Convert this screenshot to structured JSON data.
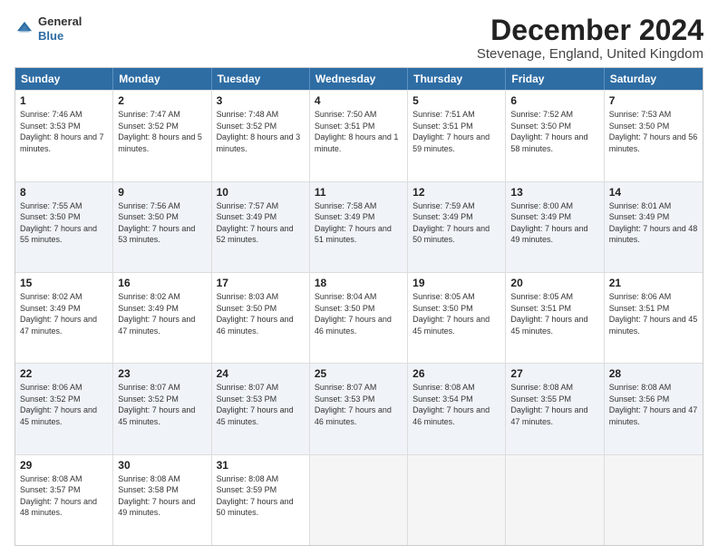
{
  "logo": {
    "general": "General",
    "blue": "Blue"
  },
  "title": "December 2024",
  "subtitle": "Stevenage, England, United Kingdom",
  "days": [
    "Sunday",
    "Monday",
    "Tuesday",
    "Wednesday",
    "Thursday",
    "Friday",
    "Saturday"
  ],
  "rows": [
    [
      {
        "day": "1",
        "sunrise": "Sunrise: 7:46 AM",
        "sunset": "Sunset: 3:53 PM",
        "daylight": "Daylight: 8 hours and 7 minutes.",
        "empty": false
      },
      {
        "day": "2",
        "sunrise": "Sunrise: 7:47 AM",
        "sunset": "Sunset: 3:52 PM",
        "daylight": "Daylight: 8 hours and 5 minutes.",
        "empty": false
      },
      {
        "day": "3",
        "sunrise": "Sunrise: 7:48 AM",
        "sunset": "Sunset: 3:52 PM",
        "daylight": "Daylight: 8 hours and 3 minutes.",
        "empty": false
      },
      {
        "day": "4",
        "sunrise": "Sunrise: 7:50 AM",
        "sunset": "Sunset: 3:51 PM",
        "daylight": "Daylight: 8 hours and 1 minute.",
        "empty": false
      },
      {
        "day": "5",
        "sunrise": "Sunrise: 7:51 AM",
        "sunset": "Sunset: 3:51 PM",
        "daylight": "Daylight: 7 hours and 59 minutes.",
        "empty": false
      },
      {
        "day": "6",
        "sunrise": "Sunrise: 7:52 AM",
        "sunset": "Sunset: 3:50 PM",
        "daylight": "Daylight: 7 hours and 58 minutes.",
        "empty": false
      },
      {
        "day": "7",
        "sunrise": "Sunrise: 7:53 AM",
        "sunset": "Sunset: 3:50 PM",
        "daylight": "Daylight: 7 hours and 56 minutes.",
        "empty": false
      }
    ],
    [
      {
        "day": "8",
        "sunrise": "Sunrise: 7:55 AM",
        "sunset": "Sunset: 3:50 PM",
        "daylight": "Daylight: 7 hours and 55 minutes.",
        "empty": false
      },
      {
        "day": "9",
        "sunrise": "Sunrise: 7:56 AM",
        "sunset": "Sunset: 3:50 PM",
        "daylight": "Daylight: 7 hours and 53 minutes.",
        "empty": false
      },
      {
        "day": "10",
        "sunrise": "Sunrise: 7:57 AM",
        "sunset": "Sunset: 3:49 PM",
        "daylight": "Daylight: 7 hours and 52 minutes.",
        "empty": false
      },
      {
        "day": "11",
        "sunrise": "Sunrise: 7:58 AM",
        "sunset": "Sunset: 3:49 PM",
        "daylight": "Daylight: 7 hours and 51 minutes.",
        "empty": false
      },
      {
        "day": "12",
        "sunrise": "Sunrise: 7:59 AM",
        "sunset": "Sunset: 3:49 PM",
        "daylight": "Daylight: 7 hours and 50 minutes.",
        "empty": false
      },
      {
        "day": "13",
        "sunrise": "Sunrise: 8:00 AM",
        "sunset": "Sunset: 3:49 PM",
        "daylight": "Daylight: 7 hours and 49 minutes.",
        "empty": false
      },
      {
        "day": "14",
        "sunrise": "Sunrise: 8:01 AM",
        "sunset": "Sunset: 3:49 PM",
        "daylight": "Daylight: 7 hours and 48 minutes.",
        "empty": false
      }
    ],
    [
      {
        "day": "15",
        "sunrise": "Sunrise: 8:02 AM",
        "sunset": "Sunset: 3:49 PM",
        "daylight": "Daylight: 7 hours and 47 minutes.",
        "empty": false
      },
      {
        "day": "16",
        "sunrise": "Sunrise: 8:02 AM",
        "sunset": "Sunset: 3:49 PM",
        "daylight": "Daylight: 7 hours and 47 minutes.",
        "empty": false
      },
      {
        "day": "17",
        "sunrise": "Sunrise: 8:03 AM",
        "sunset": "Sunset: 3:50 PM",
        "daylight": "Daylight: 7 hours and 46 minutes.",
        "empty": false
      },
      {
        "day": "18",
        "sunrise": "Sunrise: 8:04 AM",
        "sunset": "Sunset: 3:50 PM",
        "daylight": "Daylight: 7 hours and 46 minutes.",
        "empty": false
      },
      {
        "day": "19",
        "sunrise": "Sunrise: 8:05 AM",
        "sunset": "Sunset: 3:50 PM",
        "daylight": "Daylight: 7 hours and 45 minutes.",
        "empty": false
      },
      {
        "day": "20",
        "sunrise": "Sunrise: 8:05 AM",
        "sunset": "Sunset: 3:51 PM",
        "daylight": "Daylight: 7 hours and 45 minutes.",
        "empty": false
      },
      {
        "day": "21",
        "sunrise": "Sunrise: 8:06 AM",
        "sunset": "Sunset: 3:51 PM",
        "daylight": "Daylight: 7 hours and 45 minutes.",
        "empty": false
      }
    ],
    [
      {
        "day": "22",
        "sunrise": "Sunrise: 8:06 AM",
        "sunset": "Sunset: 3:52 PM",
        "daylight": "Daylight: 7 hours and 45 minutes.",
        "empty": false
      },
      {
        "day": "23",
        "sunrise": "Sunrise: 8:07 AM",
        "sunset": "Sunset: 3:52 PM",
        "daylight": "Daylight: 7 hours and 45 minutes.",
        "empty": false
      },
      {
        "day": "24",
        "sunrise": "Sunrise: 8:07 AM",
        "sunset": "Sunset: 3:53 PM",
        "daylight": "Daylight: 7 hours and 45 minutes.",
        "empty": false
      },
      {
        "day": "25",
        "sunrise": "Sunrise: 8:07 AM",
        "sunset": "Sunset: 3:53 PM",
        "daylight": "Daylight: 7 hours and 46 minutes.",
        "empty": false
      },
      {
        "day": "26",
        "sunrise": "Sunrise: 8:08 AM",
        "sunset": "Sunset: 3:54 PM",
        "daylight": "Daylight: 7 hours and 46 minutes.",
        "empty": false
      },
      {
        "day": "27",
        "sunrise": "Sunrise: 8:08 AM",
        "sunset": "Sunset: 3:55 PM",
        "daylight": "Daylight: 7 hours and 47 minutes.",
        "empty": false
      },
      {
        "day": "28",
        "sunrise": "Sunrise: 8:08 AM",
        "sunset": "Sunset: 3:56 PM",
        "daylight": "Daylight: 7 hours and 47 minutes.",
        "empty": false
      }
    ],
    [
      {
        "day": "29",
        "sunrise": "Sunrise: 8:08 AM",
        "sunset": "Sunset: 3:57 PM",
        "daylight": "Daylight: 7 hours and 48 minutes.",
        "empty": false
      },
      {
        "day": "30",
        "sunrise": "Sunrise: 8:08 AM",
        "sunset": "Sunset: 3:58 PM",
        "daylight": "Daylight: 7 hours and 49 minutes.",
        "empty": false
      },
      {
        "day": "31",
        "sunrise": "Sunrise: 8:08 AM",
        "sunset": "Sunset: 3:59 PM",
        "daylight": "Daylight: 7 hours and 50 minutes.",
        "empty": false
      },
      {
        "day": "",
        "sunrise": "",
        "sunset": "",
        "daylight": "",
        "empty": true
      },
      {
        "day": "",
        "sunrise": "",
        "sunset": "",
        "daylight": "",
        "empty": true
      },
      {
        "day": "",
        "sunrise": "",
        "sunset": "",
        "daylight": "",
        "empty": true
      },
      {
        "day": "",
        "sunrise": "",
        "sunset": "",
        "daylight": "",
        "empty": true
      }
    ]
  ]
}
